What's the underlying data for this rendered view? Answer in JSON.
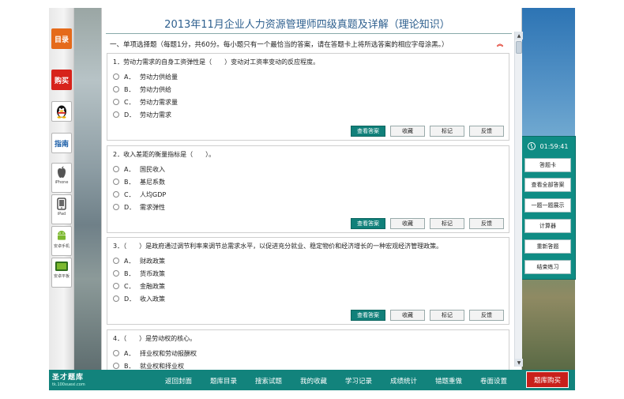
{
  "title": "2013年11月企业人力资源管理师四级真题及详解（理论知识）",
  "section_heading": "一、单项选择题（每题1分，共60分。每小题只有一个最恰当的答案，请在答题卡上将所选答案的相应字母涂黑。）",
  "left_sidebar": {
    "catalog": "目录",
    "buy": "购买",
    "guide": "指南",
    "iphone": "iPhone",
    "ipad": "iPad",
    "android_phone": "安卓手机",
    "android_pad": "安卓平板"
  },
  "right_panel": {
    "timer": "01:59:41",
    "buttons": [
      "答题卡",
      "查看全部答案",
      "一题一题展示",
      "计算器",
      "重新答题",
      "结束练习"
    ]
  },
  "question_actions": [
    "查看答案",
    "收藏",
    "标记",
    "反馈"
  ],
  "questions": [
    {
      "text": "1．劳动力需求的自身工资弹性是（　　）变动对工资率变动的反应程度。",
      "options": [
        [
          "A．",
          "劳动力供给量"
        ],
        [
          "B．",
          "劳动力供给"
        ],
        [
          "C．",
          "劳动力需求量"
        ],
        [
          "D．",
          "劳动力需求"
        ]
      ]
    },
    {
      "text": "2．收入差距的衡量指标是（　　）。",
      "options": [
        [
          "A．",
          "国民收入"
        ],
        [
          "B．",
          "基尼系数"
        ],
        [
          "C．",
          "人均GDP"
        ],
        [
          "D．",
          "需求弹性"
        ]
      ]
    },
    {
      "text": "3．（　　）是政府通过调节利率来调节总需求水平，以促进充分就业、稳定物价和经济增长的一种宏观经济管理政策。",
      "options": [
        [
          "A．",
          "财政政策"
        ],
        [
          "B．",
          "货币政策"
        ],
        [
          "C．",
          "金融政策"
        ],
        [
          "D．",
          "收入政策"
        ]
      ]
    },
    {
      "text": "4．（　　）是劳动权的核心。",
      "options": [
        [
          "A．",
          "择业权和劳动报酬权"
        ],
        [
          "B．",
          "就业权和择业权"
        ]
      ]
    }
  ],
  "bottom_bar": {
    "logo": "圣才题库",
    "logo_url": "tk.100xuexi.com",
    "nav": [
      "返回封面",
      "题库目录",
      "搜索试题",
      "我的收藏",
      "学习记录",
      "成绩统计",
      "错题重做",
      "卷面设置"
    ],
    "buy": "题库购买"
  },
  "colors": {
    "accent": "#12837c",
    "buy_red": "#c8201b",
    "title_blue": "#2d5f8e"
  }
}
